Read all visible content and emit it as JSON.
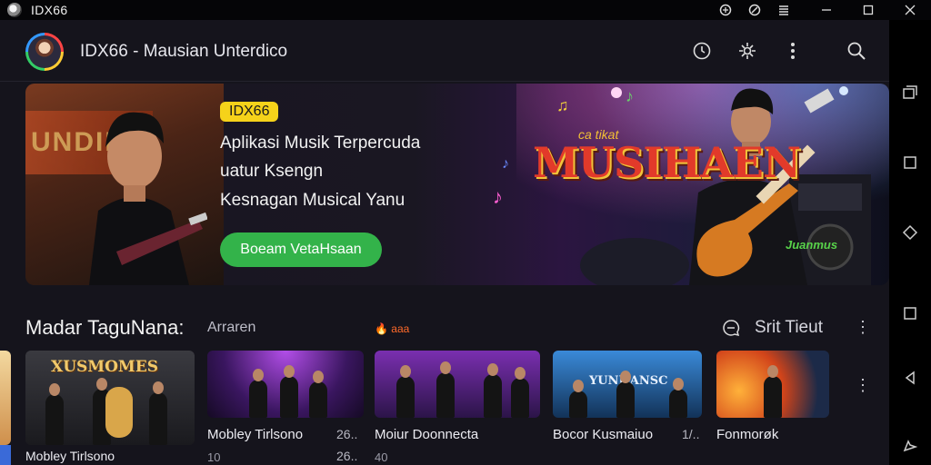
{
  "window": {
    "title": "IDX66",
    "status_icons": [
      "vpn-icon",
      "settings-icon",
      "signal-icon"
    ],
    "controls": [
      "minimize",
      "maximize",
      "close"
    ]
  },
  "header": {
    "title": "IDX66 - Mausian Unterdico",
    "icons": [
      "clock-icon",
      "settings-icon",
      "more-icon",
      "search-icon"
    ]
  },
  "hero": {
    "badge": "IDX66",
    "lines": [
      "Aplikasi Musik Terpercuda",
      "uatur Ksengn",
      "Kesnagan Musical Yanu"
    ],
    "cta_label": "Boeam VetaHsaan",
    "left_sign_text": "UNDIN",
    "logo_text": "MUSIHAEN",
    "logo_sub": "ca tikat",
    "tag2": "Juanmus",
    "colors": {
      "badge": "#f5d21a",
      "cta": "#33b34a",
      "logo": "#e23a2a"
    }
  },
  "section": {
    "title": "Madar TaguNana:",
    "sub": "Arraren",
    "fire_label": "🔥 aaa",
    "right_label": "Srit Tieut"
  },
  "cards": [
    {
      "title": "Mobley Tirlsono",
      "meta": "26..",
      "sub": "10",
      "overlay": "XUSMOMES"
    },
    {
      "title": "Moiur Doonnecta",
      "meta": "",
      "sub": "40",
      "overlay": ""
    },
    {
      "title": "Bocor Kusmaiuo",
      "meta": "1/..",
      "sub": "",
      "overlay": "YUNHANSC"
    },
    {
      "title": "Fonmorøk",
      "meta": "",
      "sub": "",
      "overlay": ""
    }
  ],
  "navrail": [
    "recents-icon",
    "square-icon",
    "diamond-icon",
    "overview-icon",
    "back-icon",
    "cast-icon"
  ]
}
